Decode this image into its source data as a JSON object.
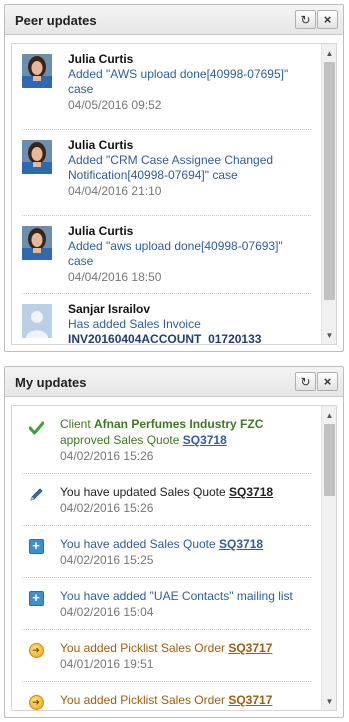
{
  "peer_panel": {
    "title": "Peer updates",
    "items": [
      {
        "name": "Julia Curtis",
        "text": "Added \"AWS upload done[40998-07695]\" case",
        "time": "04/05/2016 09:52",
        "avatar": "woman-photo"
      },
      {
        "name": "Julia Curtis",
        "text": "Added \"CRM Case Assignee Changed Notification[40998-07694]\" case",
        "time": "04/04/2016 21:10",
        "avatar": "woman-photo"
      },
      {
        "name": "Julia Curtis",
        "text": "Added \"aws upload done[40998-07693]\" case",
        "time": "04/04/2016 18:50",
        "avatar": "woman-photo"
      },
      {
        "name": "Sanjar Israilov",
        "text": "Has added Sales Invoice",
        "ref": "INV20160404ACCOUNT_01720133",
        "avatar": "placeholder-person"
      }
    ]
  },
  "my_panel": {
    "title": "My updates",
    "items": [
      {
        "icon": "check-icon",
        "pre": "Client ",
        "company": "Afnan Perfumes Industry FZC",
        "mid": " approved Sales Quote ",
        "ref": "SQ3718",
        "time": "04/02/2016 15:26"
      },
      {
        "icon": "pencil-icon",
        "pre": "You have updated Sales Quote ",
        "ref": "SQ3718",
        "time": "04/02/2016 15:26"
      },
      {
        "icon": "plus-icon",
        "pre": "You have added Sales Quote ",
        "ref": "SQ3718",
        "time": "04/02/2016 15:25"
      },
      {
        "icon": "plus-icon",
        "pre": "You have added \"UAE Contacts\" mailing list",
        "time": "04/02/2016 15:04"
      },
      {
        "icon": "coin-icon",
        "pre": "You added Picklist Sales Order ",
        "ref": "SQ3717",
        "time": "04/01/2016 19:51"
      },
      {
        "icon": "coin-icon",
        "pre": "You added Picklist Sales Order ",
        "ref": "SQ3717"
      }
    ]
  },
  "buttons": {
    "refresh": "↻",
    "close": "×"
  }
}
